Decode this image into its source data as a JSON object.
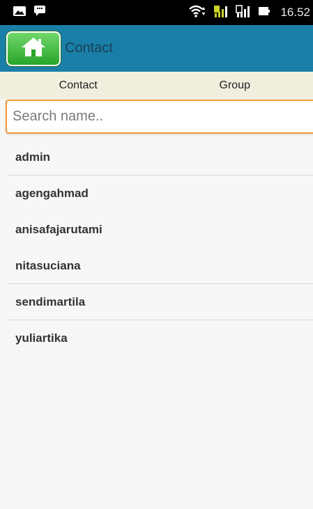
{
  "status_bar": {
    "time": "16.52",
    "icons": [
      "image-notification-icon",
      "chat-notification-icon",
      "wifi-icon",
      "signal-sim1-icon",
      "signal-sim2-icon",
      "battery-icon"
    ]
  },
  "header": {
    "title": "Contact",
    "home_icon": "home-icon"
  },
  "tabs": [
    {
      "label": "Contact"
    },
    {
      "label": "Group"
    }
  ],
  "search": {
    "placeholder": "Search name..",
    "value": ""
  },
  "contacts": [
    {
      "name": "admin"
    },
    {
      "name": "agengahmad"
    },
    {
      "name": "anisafajarutami"
    },
    {
      "name": "nitasuciana"
    },
    {
      "name": "sendimartila"
    },
    {
      "name": "yuliartika"
    }
  ],
  "colors": {
    "header_bg": "#1a7fa8",
    "tab_bg": "#f0eedd",
    "search_border": "#f09a34",
    "home_button": "#27a52a",
    "list_bg": "#f7f7f7"
  }
}
